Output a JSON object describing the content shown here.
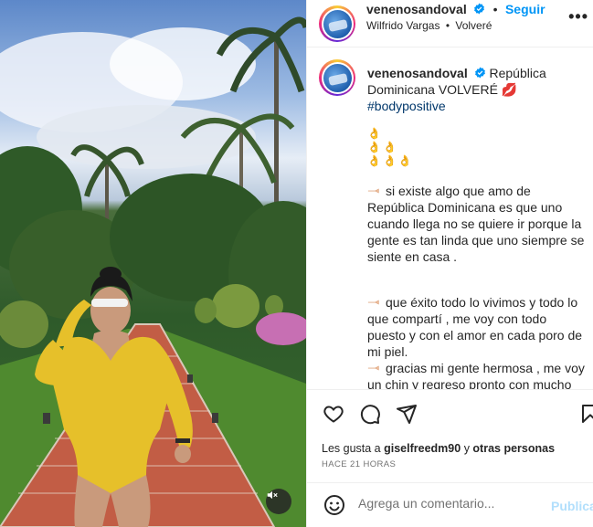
{
  "post": {
    "username": "venenosandoval",
    "follow_label": "Seguir",
    "subline_artist": "Wilfrido Vargas",
    "subline_track": "Volveré",
    "more_label": "•••"
  },
  "caption": {
    "username": "venenosandoval",
    "text_line1": "República",
    "text_line2": "Dominicana VOLVERÉ",
    "kiss_emoji": "💋",
    "hashtag": "#bodypositive",
    "emoji_row1": "👌",
    "emoji_row2": "👌👌",
    "emoji_row3": "👌👌👌",
    "paragraph1": "si existe algo que amo de República Dominicana es que uno cuando llega no se quiere ir porque la gente es tan linda que uno siempre se siente en casa .",
    "paragraph2": "que éxito todo lo vivimos y todo lo que compartí , me voy con todo puesto y con el amor en cada poro de mi piel.",
    "paragraph3": "gracias mi gente hermosa , me voy un chin y regreso pronto con mucho"
  },
  "engagement": {
    "likes_prefix": "Les gusta a",
    "likes_user": "giselfreedm90",
    "likes_join": "y",
    "likes_others": "otras personas",
    "timestamp": "HACE 21 HORAS"
  },
  "comment": {
    "placeholder": "Agrega un comentario...",
    "publish_label": "Publicar"
  },
  "colors": {
    "accent": "#0095f6",
    "publish_disabled": "#b2dffc",
    "hashtag": "#00376b"
  }
}
